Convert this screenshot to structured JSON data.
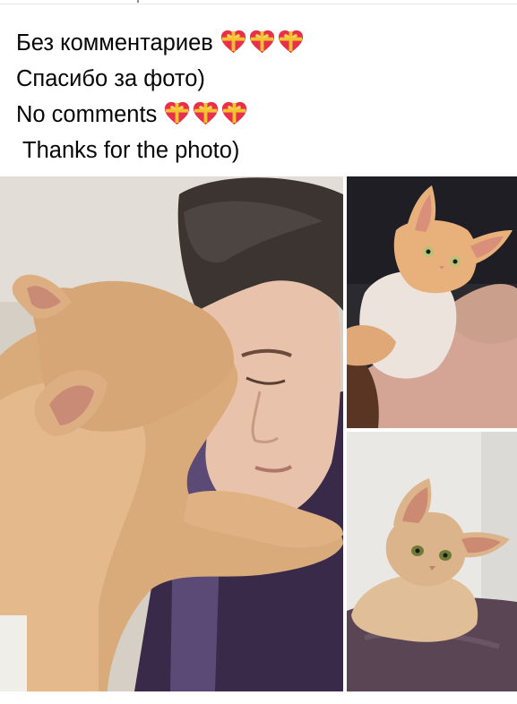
{
  "post": {
    "lines": [
      {
        "text": "Без комментариев",
        "emoji_count": 3
      },
      {
        "text": "Спасибо за фото)",
        "emoji_count": 0
      },
      {
        "text": "No comments",
        "emoji_count": 3
      },
      {
        "text": "Thanks for the photo)",
        "emoji_count": 0
      }
    ],
    "emoji_icon": "heart-with-ribbon-icon"
  },
  "photos": [
    {
      "name": "photo-man-kissed-by-cat",
      "subject": "man and curly cat"
    },
    {
      "name": "photo-cat-held-in-arms",
      "subject": "cat held in arms"
    },
    {
      "name": "photo-cat-on-sofa",
      "subject": "cat lying on sofa"
    }
  ],
  "colors": {
    "text": "#050505",
    "heart": "#e8304a",
    "ribbon": "#f2c230",
    "cat_fur": "#d8ab7c",
    "background_wall": "#cfc7bd"
  }
}
